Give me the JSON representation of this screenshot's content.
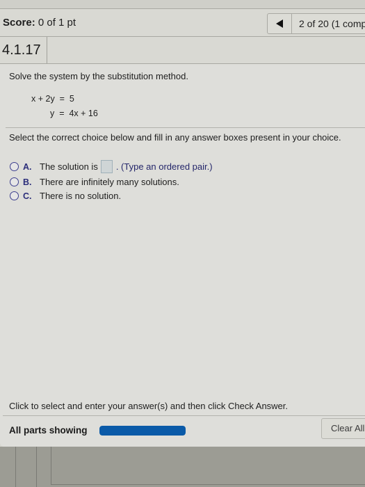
{
  "header": {
    "score_label": "Score:",
    "score_value": "0 of 1 pt",
    "nav_prev_icon": "triangle-left-icon",
    "nav_progress": "2 of 20 (1 comp"
  },
  "question": {
    "id": "4.1.17",
    "instruction": "Solve the system by the substitution method.",
    "equations": [
      "x + 2y  =  5",
      "y  =  4x + 16"
    ],
    "select_prompt": "Select the correct choice below and fill in any answer boxes present in your choice.",
    "choices": [
      {
        "letter": "A.",
        "text": "The solution is",
        "answer_value": "",
        "hint": ". (Type an ordered pair.)",
        "selected": false
      },
      {
        "letter": "B.",
        "text": "There are infinitely many solutions.",
        "selected": false
      },
      {
        "letter": "C.",
        "text": "There is no solution.",
        "selected": false
      }
    ]
  },
  "footer": {
    "instruction": "Click to select and enter your answer(s) and then click Check Answer.",
    "parts_label": "All parts showing",
    "progress_fraction": 1.0,
    "progress_color": "#0a5aa8",
    "clear_all_label": "Clear All"
  }
}
